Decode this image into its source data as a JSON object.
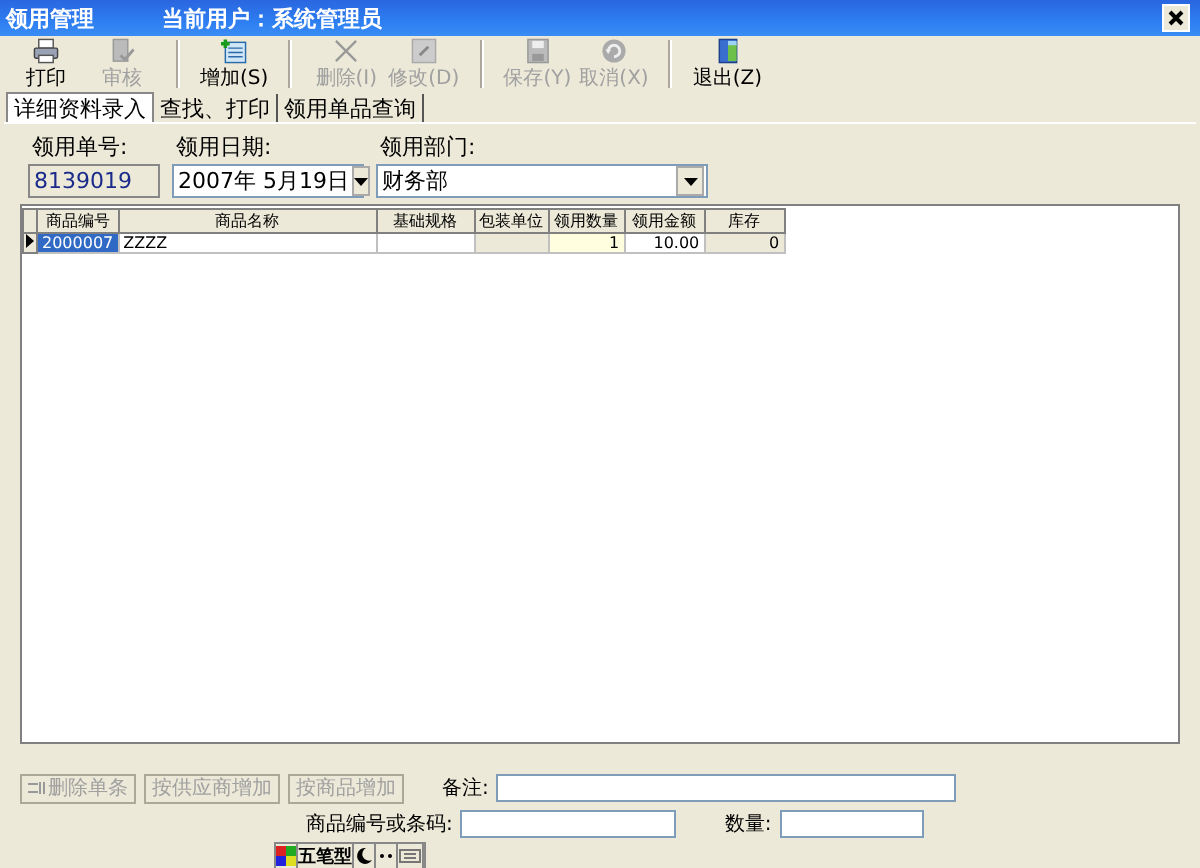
{
  "window": {
    "title": "领用管理",
    "user_label": "当前用户：系统管理员"
  },
  "toolbar": [
    {
      "label": "打印",
      "kind": "print",
      "disabled": false,
      "group_end": false
    },
    {
      "label": "审核",
      "kind": "audit",
      "disabled": true,
      "group_end": true
    },
    {
      "label": "增加(S)",
      "kind": "add",
      "disabled": false,
      "group_end": true
    },
    {
      "label": "删除(I)",
      "kind": "delete",
      "disabled": true,
      "group_end": false
    },
    {
      "label": "修改(D)",
      "kind": "edit",
      "disabled": true,
      "group_end": true
    },
    {
      "label": "保存(Y)",
      "kind": "save",
      "disabled": true,
      "group_end": false
    },
    {
      "label": "取消(X)",
      "kind": "cancel",
      "disabled": true,
      "group_end": true
    },
    {
      "label": "退出(Z)",
      "kind": "exit",
      "disabled": false,
      "group_end": false
    }
  ],
  "tabs": [
    {
      "label": "详细资料录入",
      "selected": true
    },
    {
      "label": "查找、打印",
      "selected": false
    },
    {
      "label": "领用单品查询",
      "selected": false
    }
  ],
  "form": {
    "order_no": {
      "label": "领用单号:",
      "value": "8139019"
    },
    "date": {
      "label": "领用日期:",
      "value": "2007年 5月19日"
    },
    "department": {
      "label": "领用部门:",
      "value": "财务部"
    }
  },
  "table": {
    "columns": [
      {
        "label": "商品编号",
        "kind": "text"
      },
      {
        "label": "商品名称",
        "kind": "text"
      },
      {
        "label": "基础规格",
        "kind": "text"
      },
      {
        "label": "包装单位",
        "kind": "readonly"
      },
      {
        "label": "领用数量",
        "kind": "editing"
      },
      {
        "label": "领用金额",
        "kind": "number"
      },
      {
        "label": "库存",
        "kind": "readonly"
      }
    ],
    "rows": [
      {
        "selected": true,
        "cells": [
          "2000007",
          "ZZZZ",
          "",
          "",
          "1",
          "10.00",
          "0"
        ]
      }
    ]
  },
  "bottom": {
    "buttons": [
      {
        "label": "删除单条",
        "kind": "icon",
        "disabled": true
      },
      {
        "label": "按供应商增加",
        "kind": "plain",
        "disabled": true
      },
      {
        "label": "按商品增加",
        "kind": "plain",
        "disabled": true
      }
    ],
    "remark_label": "备注:",
    "code_label": "商品编号或条码:",
    "quantity_label": "数量:"
  },
  "ime": {
    "mode": "五笔型"
  }
}
